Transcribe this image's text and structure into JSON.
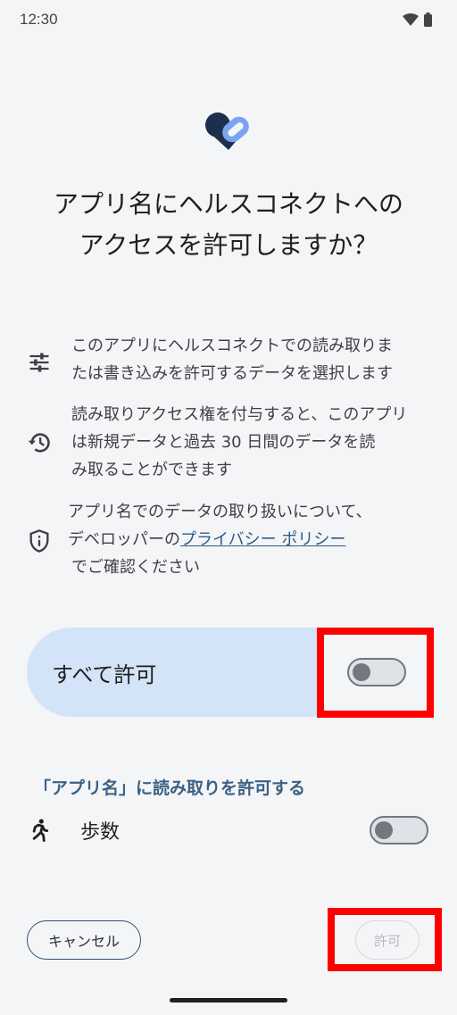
{
  "status_bar": {
    "time": "12:30"
  },
  "title": "アプリ名にヘルスコネクトへの アクセスを許可しますか？",
  "info": [
    {
      "icon": "tune-icon",
      "lines": [
        "このアプリにヘルスコネクトでの読み取りま",
        "たは書き込みを許可するデータを選択します"
      ]
    },
    {
      "icon": "history-icon",
      "lines": [
        "読み取りアクセス権を付与すると、このアプリ",
        "は新規データと過去 30 日間のデータを読",
        "み取ることができます"
      ]
    },
    {
      "icon": "shield-icon",
      "line1": "アプリ名でのデータの取り扱いについて、",
      "line2_prefix": "デベロッパーの",
      "link": "プライバシー ポリシー",
      "line3": "でご確認ください"
    }
  ],
  "allow_all": {
    "label": "すべて許可",
    "checked": false
  },
  "read_section": {
    "header": "「アプリ名」に読み取りを許可する",
    "items": [
      {
        "label": "歩数",
        "icon": "walk-icon",
        "checked": false
      }
    ]
  },
  "buttons": {
    "cancel": "キャンセル",
    "allow": "許可"
  },
  "colors": {
    "accent": "#3b6184",
    "card": "#d3e4f8",
    "highlight": "#ff0000"
  }
}
